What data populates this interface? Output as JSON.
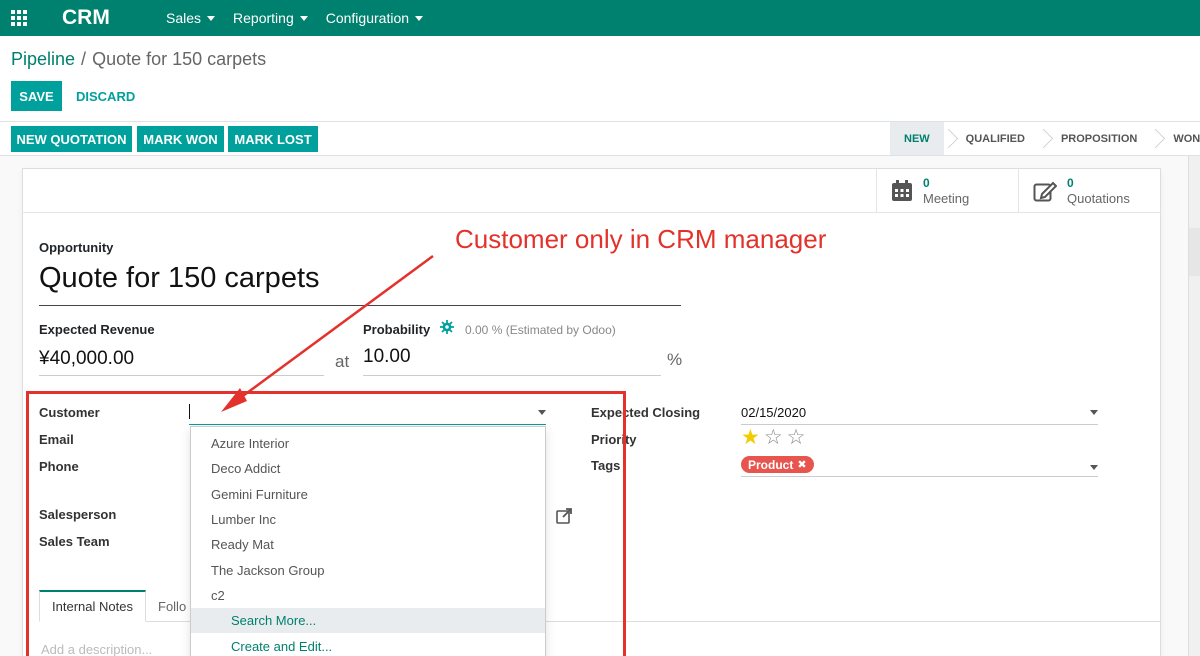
{
  "navbar": {
    "brand": "CRM",
    "menu": [
      {
        "label": "Sales"
      },
      {
        "label": "Reporting"
      },
      {
        "label": "Configuration"
      }
    ]
  },
  "breadcrumb": {
    "parent": "Pipeline",
    "separator": "/",
    "current": "Quote for 150 carpets"
  },
  "form_buttons": {
    "save": "SAVE",
    "discard": "DISCARD"
  },
  "status_buttons": {
    "new_quotation": "NEW QUOTATION",
    "mark_won": "MARK WON",
    "mark_lost": "MARK LOST"
  },
  "stages": [
    {
      "label": "NEW",
      "active": true
    },
    {
      "label": "QUALIFIED",
      "active": false
    },
    {
      "label": "PROPOSITION",
      "active": false
    },
    {
      "label": "WON",
      "active": false
    }
  ],
  "smart_buttons": {
    "meeting": {
      "count": "0",
      "label": "Meeting",
      "icon": "calendar-icon"
    },
    "quotations": {
      "count": "0",
      "label": "Quotations",
      "icon": "edit-icon"
    }
  },
  "opportunity": {
    "label": "Opportunity",
    "name": "Quote for 150 carpets",
    "expected_revenue_label": "Expected Revenue",
    "expected_revenue": "¥40,000.00",
    "at": "at",
    "probability_label": "Probability",
    "probability_estimate": "0.00 % (Estimated by Odoo)",
    "probability": "10.00",
    "percent_sign": "%"
  },
  "fields": {
    "customer": "Customer",
    "email": "Email",
    "phone": "Phone",
    "salesperson": "Salesperson",
    "sales_team": "Sales Team",
    "expected_closing": "Expected Closing",
    "expected_closing_value": "02/15/2020",
    "priority": "Priority",
    "priority_value": 1,
    "priority_max": 3,
    "tags": "Tags",
    "tag_value": "Product"
  },
  "customer_dropdown": {
    "options": [
      "Azure Interior",
      "Deco Addict",
      "Gemini Furniture",
      "Lumber Inc",
      "Ready Mat",
      "The Jackson Group",
      "c2"
    ],
    "search_more": "Search More...",
    "create_edit": "Create and Edit..."
  },
  "tabs": {
    "internal_notes": "Internal Notes",
    "followup": "Follo"
  },
  "description_placeholder": "Add a description...",
  "annotation": {
    "text": "Customer only in CRM manager",
    "color": "#e3322b"
  },
  "colors": {
    "brand": "#00806e",
    "button": "#00a09d",
    "tag": "#e8554e",
    "star": "#f3cc00"
  }
}
